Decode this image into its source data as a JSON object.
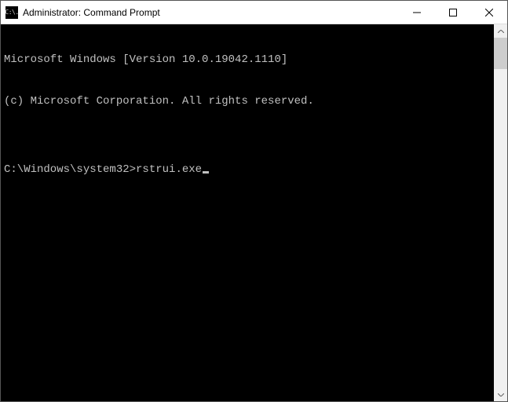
{
  "window": {
    "title": "Administrator: Command Prompt",
    "icon_label": "C:\\."
  },
  "terminal": {
    "line1": "Microsoft Windows [Version 10.0.19042.1110]",
    "line2": "(c) Microsoft Corporation. All rights reserved.",
    "blank": "",
    "prompt": "C:\\Windows\\system32>",
    "input": "rstrui.exe"
  }
}
